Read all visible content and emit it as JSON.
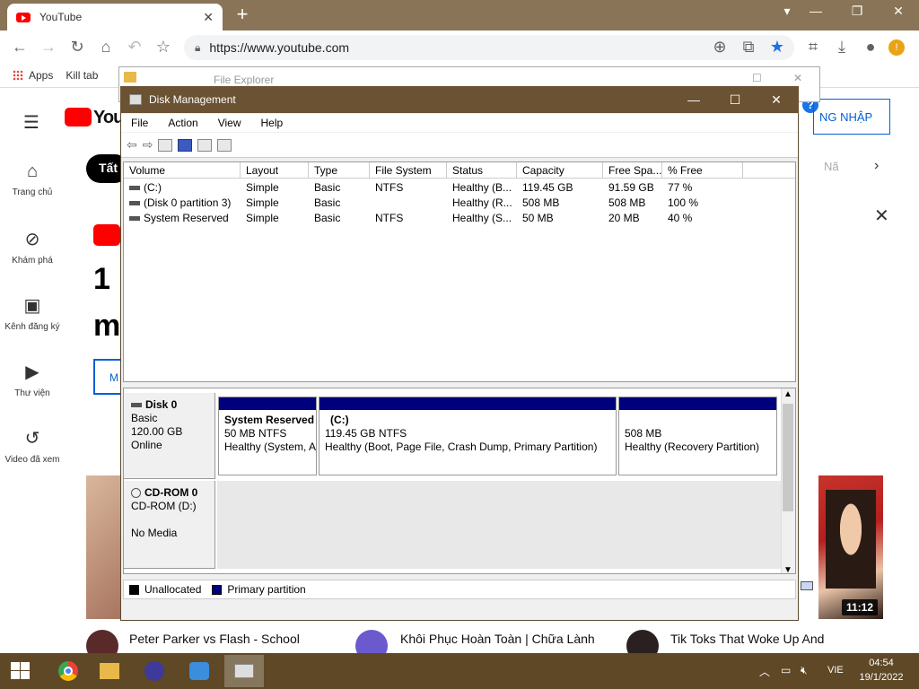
{
  "browser": {
    "tab_title": "YouTube",
    "tab_close": "✕",
    "new_tab": "+",
    "url": "https://www.youtube.com",
    "bookmarks": [
      "Apps",
      "Kill tab"
    ]
  },
  "youtube": {
    "logo_text": "You",
    "sidebar": [
      {
        "icon": "⌂",
        "label": "Trang chủ"
      },
      {
        "icon": "⊘",
        "label": "Khám phá"
      },
      {
        "icon": "▣",
        "label": "Kênh đăng ký"
      },
      {
        "icon": "▶",
        "label": "Thư viện"
      },
      {
        "icon": "↺",
        "label": "Video đã xem"
      }
    ],
    "login_label": "NG NHẬP",
    "chip_label": "Tất",
    "chip_next": "Nã",
    "big_text_1": "1",
    "big_text_2": "m",
    "m_button": "M",
    "video_duration": "11:12",
    "videos": [
      {
        "title": "Peter Parker vs Flash - School"
      },
      {
        "title": "Khôi Phục Hoàn Toàn | Chữa Lành"
      },
      {
        "title": "Tik Toks That Woke Up And"
      }
    ]
  },
  "file_explorer": {
    "title": "File Explorer"
  },
  "disk_management": {
    "title": "Disk Management",
    "menu": [
      "File",
      "Action",
      "View",
      "Help"
    ],
    "columns": [
      "Volume",
      "Layout",
      "Type",
      "File System",
      "Status",
      "Capacity",
      "Free Spa...",
      "% Free"
    ],
    "volumes": [
      {
        "volume": "(C:)",
        "layout": "Simple",
        "type": "Basic",
        "fs": "NTFS",
        "status": "Healthy (B...",
        "capacity": "119.45 GB",
        "free": "91.59 GB",
        "pct": "77 %"
      },
      {
        "volume": "(Disk 0 partition 3)",
        "layout": "Simple",
        "type": "Basic",
        "fs": "",
        "status": "Healthy (R...",
        "capacity": "508 MB",
        "free": "508 MB",
        "pct": "100 %"
      },
      {
        "volume": "System Reserved",
        "layout": "Simple",
        "type": "Basic",
        "fs": "NTFS",
        "status": "Healthy (S...",
        "capacity": "50 MB",
        "free": "20 MB",
        "pct": "40 %"
      }
    ],
    "disk0": {
      "name": "Disk 0",
      "type": "Basic",
      "size": "120.00 GB",
      "state": "Online",
      "partitions": [
        {
          "name": "System Reserved",
          "size": "50 MB NTFS",
          "status": "Healthy (System, A"
        },
        {
          "name": "(C:)",
          "size": "119.45 GB NTFS",
          "status": "Healthy (Boot, Page File, Crash Dump, Primary Partition)"
        },
        {
          "name": "",
          "size": "508 MB",
          "status": "Healthy (Recovery Partition)"
        }
      ]
    },
    "cdrom": {
      "name": "CD-ROM 0",
      "type": "CD-ROM (D:)",
      "state": "No Media"
    },
    "legend": [
      {
        "label": "Unallocated",
        "color": "#000000"
      },
      {
        "label": "Primary partition",
        "color": "#00007f"
      }
    ]
  },
  "taskbar": {
    "language": "VIE",
    "time": "04:54",
    "date": "19/1/2022"
  }
}
